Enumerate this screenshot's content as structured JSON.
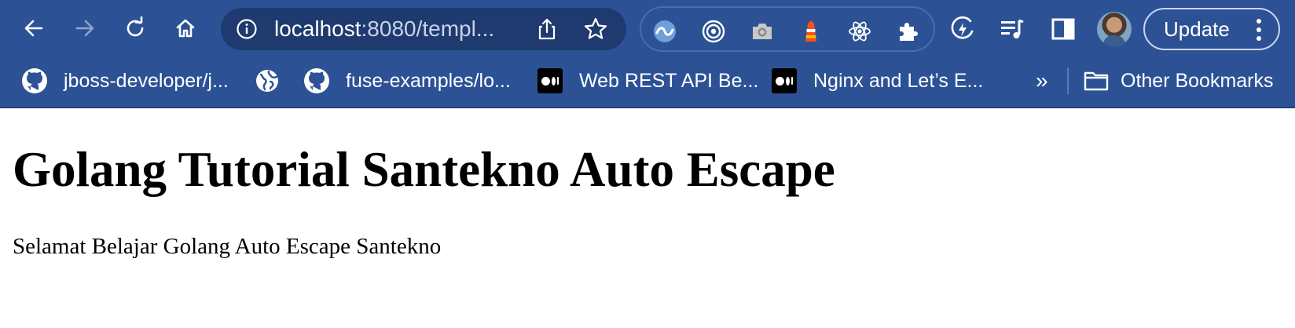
{
  "browser": {
    "address_bar": {
      "url_host": "localhost",
      "url_rest": ":8080/templ..."
    },
    "update_button_label": "Update",
    "bookmarks": [
      {
        "icon": "github-icon",
        "label": "jboss-developer/j..."
      },
      {
        "icon": "globe-icon",
        "label": ""
      },
      {
        "icon": "github-icon",
        "label": "fuse-examples/lo..."
      },
      {
        "icon": "medium-icon",
        "label": "Web REST API Be..."
      },
      {
        "icon": "medium-icon",
        "label": "Nginx and Let’s E..."
      }
    ],
    "bookmarks_overflow": "»",
    "other_bookmarks_label": "Other Bookmarks",
    "theme": {
      "toolbar_bg": "#2c5295",
      "omnibox_bg": "#1e3a6e",
      "text": "#ffffff"
    }
  },
  "page": {
    "heading": "Golang Tutorial Santekno Auto Escape",
    "paragraph": "Selamat Belajar Golang Auto Escape Santekno"
  }
}
